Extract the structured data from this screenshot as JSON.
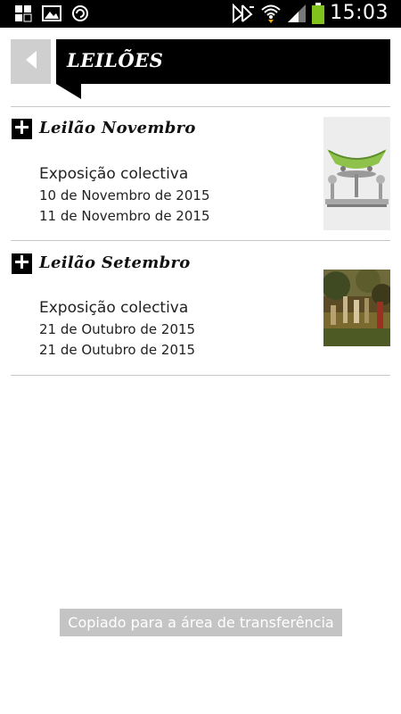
{
  "status_bar": {
    "time": "15:03",
    "left_icons": [
      "app-notification-icon",
      "image-icon",
      "sync-icon"
    ],
    "right_icons": [
      "nfc-icon",
      "wifi-icon",
      "signal-icon",
      "battery-icon"
    ]
  },
  "header": {
    "title": "LEILÕES",
    "back_icon": "back-arrow-icon"
  },
  "auctions": [
    {
      "title": "Leilão Novembro",
      "subtitle": "Exposição colectiva",
      "date_start": "10 de Novembro de 2015",
      "date_end": "11 de Novembro de 2015",
      "thumbnail": "silver-centerpiece-image"
    },
    {
      "title": "Leilão Setembro",
      "subtitle": "Exposição colectiva",
      "date_start": "21 de Outubro de 2015",
      "date_end": "21 de Outubro de 2015",
      "thumbnail": "painting-image"
    }
  ],
  "toast": {
    "message": "Copiado para a área de transferência"
  },
  "colors": {
    "header_bg": "#000000",
    "back_button_bg": "#cfcfcf",
    "battery": "#7fc31c",
    "toast_bg": "#c4c4c4"
  }
}
